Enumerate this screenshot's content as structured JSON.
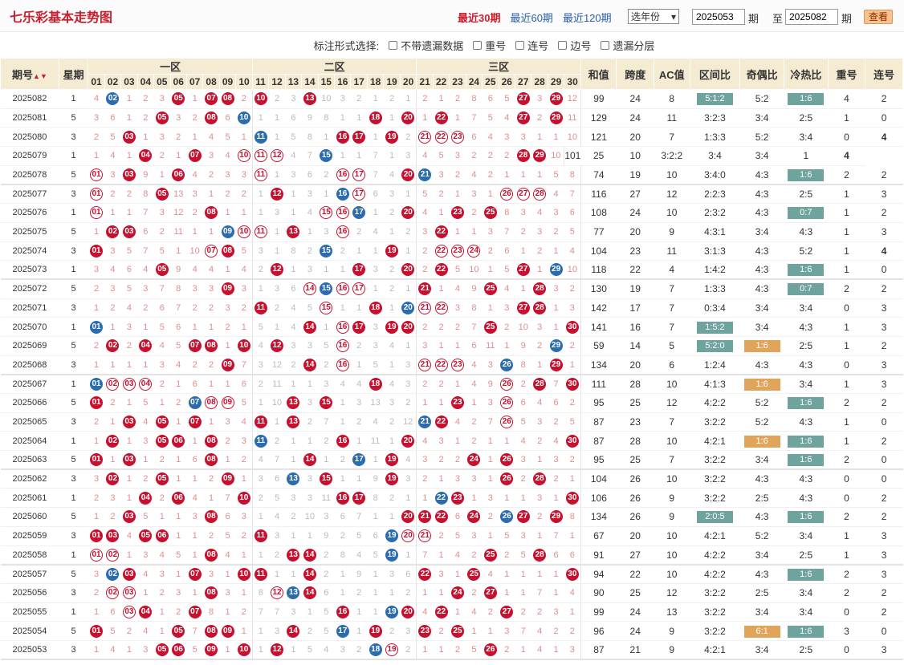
{
  "title": "七乐彩基本走势图",
  "periods": [
    {
      "label": "最近30期",
      "active": true
    },
    {
      "label": "最近60期",
      "active": false
    },
    {
      "label": "最近120期",
      "active": false
    }
  ],
  "year_select": "选年份",
  "range": {
    "from": "2025053",
    "to": "2025082",
    "qi": "期",
    "zhi": "至",
    "btn": "查看"
  },
  "opts": {
    "label": "标注形式选择:",
    "items": [
      "不带遗漏数据",
      "重号",
      "连号",
      "边号",
      "遗漏分层"
    ]
  },
  "headers": {
    "pid": "期号",
    "week": "星期",
    "z1": "一区",
    "z2": "二区",
    "z3": "三区",
    "sum": "和值",
    "span": "跨度",
    "ac": "AC值",
    "qjb": "区间比",
    "job": "奇偶比",
    "lrb": "冷热比",
    "chong": "重号",
    "lian": "连号"
  },
  "nums": [
    "01",
    "02",
    "03",
    "04",
    "05",
    "06",
    "07",
    "08",
    "09",
    "10",
    "11",
    "12",
    "13",
    "14",
    "15",
    "16",
    "17",
    "18",
    "19",
    "20",
    "21",
    "22",
    "23",
    "24",
    "25",
    "26",
    "27",
    "28",
    "29",
    "30"
  ],
  "rows": [
    {
      "id": "2025082",
      "w": "1",
      "c": "4 B02 1 2 3 R05 1 R07 R08 2 R10 2 3 R13 10 3 2 1 2 1 2 1 2 8 6 5 R27 3 R29 12",
      "s": [
        "99",
        "24",
        "8",
        "5:1:2",
        "5:2",
        "1:6",
        "4",
        "2"
      ],
      "t": [
        1,
        0,
        1
      ]
    },
    {
      "id": "2025081",
      "w": "5",
      "c": "3 6 1 2 R05 3 2 R08 6 B10 1 1 6 9 8 1 1 R18 1 R20 1 R22 1 7 5 4 R27 2 R29 11",
      "s": [
        "129",
        "24",
        "11",
        "3:2:3",
        "3:4",
        "2:5",
        "1",
        "0"
      ],
      "t": [
        0,
        0,
        0
      ]
    },
    {
      "id": "2025080",
      "w": "3",
      "c": "2 5 R03 1 3 2 1 4 5 1 B11 1 5 8 1 R16 R17 1 R19 2 O21 O22 O23 6 4 3 3 1 1 10",
      "s": [
        "121",
        "20",
        "7",
        "1:3:3",
        "5:2",
        "3:4",
        "0",
        "4"
      ],
      "t": [
        0,
        0,
        0
      ]
    },
    {
      "id": "2025079",
      "w": "1",
      "c": "1 4 1 R04 2 1 R07 3 4 O10 O11 O12 4 7 B15 1 1 7 1 3 4 5 3 2 2 2 R28 R29 10",
      "s": [
        "101",
        "25",
        "10",
        "3:2:2",
        "3:4",
        "3:4",
        "1",
        "4"
      ],
      "t": [
        0,
        0,
        0
      ]
    },
    {
      "id": "2025078",
      "w": "5",
      "c": "O01 3 R03 9 1 R06 4 2 3 3 O11 1 3 6 2 O16 O17 7 4 R20 B21 3 2 4 2 1 1 1 5 8",
      "s": [
        "74",
        "19",
        "10",
        "3:4:0",
        "4:3",
        "1:6",
        "2",
        "2"
      ],
      "t": [
        0,
        0,
        1
      ],
      "end": true
    },
    {
      "id": "2025077",
      "w": "3",
      "c": "O01 2 2 8 R05 13 3 1 2 2 1 R12 1 3 1 B16 O17 6 3 1 5 2 1 3 1 O26 O27 O28 4 7",
      "s": [
        "116",
        "27",
        "12",
        "2:2:3",
        "4:3",
        "2:5",
        "1",
        "3"
      ],
      "t": [
        0,
        0,
        0
      ]
    },
    {
      "id": "2025076",
      "w": "1",
      "c": "O01 1 1 7 3 12 2 R08 1 1 1 3 1 4 O15 O16 B17 1 2 R20 4 1 R23 2 R25 8 3 4 3 6",
      "s": [
        "108",
        "24",
        "10",
        "2:3:2",
        "4:3",
        "0:7",
        "1",
        "2"
      ],
      "t": [
        0,
        0,
        1
      ]
    },
    {
      "id": "2025075",
      "w": "5",
      "c": "1 R02 R03 6 2 11 1 1 B09 O10 O11 1 R13 1 3 O16 2 4 1 2 3 R22 1 1 3 7 2 3 2 5",
      "s": [
        "77",
        "20",
        "9",
        "4:3:1",
        "3:4",
        "4:3",
        "1",
        "3"
      ],
      "t": [
        0,
        0,
        0
      ]
    },
    {
      "id": "2025074",
      "w": "3",
      "c": "R01 3 5 7 5 1 10 O07 R08 5 3 1 8 2 B15 2 1 1 R19 1 2 O22 O23 O24 2 6 1 2 1 4",
      "s": [
        "104",
        "23",
        "11",
        "3:1:3",
        "4:3",
        "5:2",
        "1",
        "4"
      ],
      "t": [
        0,
        0,
        0
      ]
    },
    {
      "id": "2025073",
      "w": "1",
      "c": "3 4 6 4 R05 9 4 4 1 4 2 R12 1 3 1 1 R17 3 2 R20 2 R22 5 10 1 5 R27 1 B29 10",
      "s": [
        "118",
        "22",
        "4",
        "1:4:2",
        "4:3",
        "1:6",
        "1",
        "0"
      ],
      "t": [
        0,
        0,
        1
      ],
      "end": true
    },
    {
      "id": "2025072",
      "w": "5",
      "c": "2 3 5 3 7 8 3 3 R09 3 1 3 6 O14 B15 O16 O17 1 2 1 R21 1 4 9 R25 4 1 R28 3 2",
      "s": [
        "130",
        "19",
        "7",
        "1:3:3",
        "4:3",
        "0:7",
        "2",
        "2"
      ],
      "t": [
        0,
        0,
        1
      ]
    },
    {
      "id": "2025071",
      "w": "3",
      "c": "1 2 4 2 6 7 2 2 3 2 R11 2 4 5 O15 1 1 R18 1 B20 O21 O22 3 8 1 3 R27 R28 1 3",
      "s": [
        "142",
        "17",
        "7",
        "0:3:4",
        "3:4",
        "3:4",
        "0",
        "3"
      ],
      "t": [
        0,
        0,
        0
      ]
    },
    {
      "id": "2025070",
      "w": "1",
      "c": "B01 1 3 1 5 6 1 1 2 1 5 1 4 R14 1 O16 R17 3 R19 R20 2 2 2 7 R25 2 10 3 1 R30",
      "s": [
        "141",
        "16",
        "7",
        "1:5:2",
        "3:4",
        "4:3",
        "1",
        "3"
      ],
      "t": [
        1,
        0,
        0
      ]
    },
    {
      "id": "2025069",
      "w": "5",
      "c": "2 R02 2 R04 4 5 R07 R08 1 R10 4 R12 3 3 5 O16 2 3 4 1 3 1 1 6 11 1 9 2 B29 2",
      "s": [
        "59",
        "14",
        "5",
        "5:2:0",
        "1:6",
        "2:5",
        "1",
        "2"
      ],
      "t": [
        1,
        1,
        0
      ]
    },
    {
      "id": "2025068",
      "w": "3",
      "c": "1 1 1 1 3 4 2 2 R09 7 3 12 2 R14 2 O16 1 5 1 3 O21 O22 O23 4 3 B26 8 1 R29 1",
      "s": [
        "134",
        "20",
        "6",
        "1:2:4",
        "4:3",
        "4:3",
        "0",
        "3"
      ],
      "t": [
        0,
        0,
        0
      ],
      "end": true
    },
    {
      "id": "2025067",
      "w": "1",
      "c": "B01 O02 O03 O04 2 1 6 1 1 6 2 11 1 1 3 4 4 R18 4 3 2 2 1 4 9 O26 2 R28 7 R30",
      "s": [
        "111",
        "28",
        "10",
        "4:1:3",
        "1:6",
        "3:4",
        "1",
        "3"
      ],
      "t": [
        0,
        1,
        0
      ]
    },
    {
      "id": "2025066",
      "w": "5",
      "c": "R01 2 1 5 1 2 B07 O08 O09 5 1 10 R13 3 R15 1 3 13 3 2 1 1 R23 1 3 O26 6 4 6 2",
      "s": [
        "95",
        "25",
        "12",
        "4:2:2",
        "5:2",
        "1:6",
        "2",
        "2"
      ],
      "t": [
        0,
        0,
        1
      ]
    },
    {
      "id": "2025065",
      "w": "3",
      "c": "2 1 R03 4 R05 1 R07 1 3 4 R11 1 R13 2 7 1 2 4 2 12 B21 R22 4 2 7 O26 5 3 2 5",
      "s": [
        "87",
        "23",
        "7",
        "3:2:2",
        "5:2",
        "4:3",
        "1",
        "0"
      ],
      "t": [
        0,
        0,
        0
      ]
    },
    {
      "id": "2025064",
      "w": "1",
      "c": "1 R02 1 3 R05 R06 1 R08 2 3 B11 2 1 1 2 R16 1 11 1 R20 4 3 1 2 1 1 4 2 4 R30",
      "s": [
        "87",
        "28",
        "10",
        "4:2:1",
        "1:6",
        "1:6",
        "1",
        "2"
      ],
      "t": [
        0,
        1,
        1
      ]
    },
    {
      "id": "2025063",
      "w": "5",
      "c": "R01 1 R03 1 2 1 6 R08 1 2 4 7 1 R14 1 2 B17 1 R19 4 3 2 2 R24 1 R26 3 1 3 2",
      "s": [
        "95",
        "25",
        "7",
        "3:2:2",
        "3:4",
        "1:6",
        "2",
        "0"
      ],
      "t": [
        0,
        0,
        1
      ],
      "end": true
    },
    {
      "id": "2025062",
      "w": "3",
      "c": "3 R02 1 2 R05 1 1 2 R09 1 3 6 B13 3 R15 1 1 9 R19 3 2 1 3 3 1 R26 2 R28 2 1",
      "s": [
        "104",
        "26",
        "10",
        "3:2:2",
        "4:3",
        "4:3",
        "0",
        "0"
      ],
      "t": [
        0,
        0,
        0
      ]
    },
    {
      "id": "2025061",
      "w": "1",
      "c": "2 3 1 R04 2 R06 4 1 7 R10 2 5 3 3 11 R16 R17 8 2 1 1 B22 R23 1 3 1 1 3 1 R30",
      "s": [
        "106",
        "26",
        "9",
        "3:2:2",
        "2:5",
        "4:3",
        "0",
        "2"
      ],
      "t": [
        0,
        0,
        0
      ]
    },
    {
      "id": "2025060",
      "w": "5",
      "c": "1 2 R03 5 1 1 3 R08 6 3 1 4 2 10 3 6 7 1 1 R20 R21 R22 6 R24 2 B26 R27 2 R29 8",
      "s": [
        "134",
        "26",
        "9",
        "2:0:5",
        "4:3",
        "1:6",
        "2",
        "2"
      ],
      "t": [
        1,
        0,
        1
      ]
    },
    {
      "id": "2025059",
      "w": "3",
      "c": "R01 R03 4 R05 R06 1 1 2 5 2 R11 3 1 1 9 2 5 6 B19 O20 O21 2 5 3 1 5 3 1 7 1",
      "s": [
        "67",
        "20",
        "10",
        "4:2:1",
        "5:2",
        "3:4",
        "1",
        "3"
      ],
      "t": [
        0,
        0,
        0
      ]
    },
    {
      "id": "2025058",
      "w": "1",
      "c": "O01 O02 1 3 4 5 1 R08 4 1 1 2 R13 R14 2 8 4 5 B19 1 7 1 4 2 R25 2 5 R28 6 6",
      "s": [
        "91",
        "27",
        "10",
        "4:2:2",
        "3:4",
        "2:5",
        "1",
        "3"
      ],
      "t": [
        0,
        0,
        0
      ],
      "end": true
    },
    {
      "id": "2025057",
      "w": "5",
      "c": "3 B02 R03 4 3 1 R07 3 1 R10 R11 1 1 R14 2 1 9 1 3 6 R22 3 1 R25 4 1 1 1 1 R30",
      "s": [
        "94",
        "22",
        "10",
        "4:2:2",
        "4:3",
        "1:6",
        "2",
        "3"
      ],
      "t": [
        0,
        0,
        1
      ]
    },
    {
      "id": "2025056",
      "w": "3",
      "c": "2 O02 O03 1 2 3 1 R08 3 1 8 O12 B13 R14 6 1 2 1 1 2 1 1 R24 2 R27 1 1 7 1 4",
      "s": [
        "90",
        "25",
        "12",
        "3:2:2",
        "2:5",
        "3:4",
        "2",
        "2"
      ],
      "t": [
        0,
        0,
        0
      ]
    },
    {
      "id": "2025055",
      "w": "1",
      "c": "1 6 O03 R04 1 2 R07 8 1 2 7 7 3 1 5 R16 1 1 B19 R20 4 R22 1 4 2 R27 2 2 3 1",
      "s": [
        "99",
        "24",
        "13",
        "3:2:2",
        "3:4",
        "3:4",
        "0",
        "2"
      ],
      "t": [
        0,
        0,
        0
      ]
    },
    {
      "id": "2025054",
      "w": "5",
      "c": "R01 5 2 4 1 R05 7 R08 R09 1 1 3 R14 2 5 B17 1 R19 2 3 R23 2 R25 1 1 3 7 4 2 2",
      "s": [
        "96",
        "24",
        "9",
        "3:2:2",
        "6:1",
        "1:6",
        "3",
        "0"
      ],
      "t": [
        0,
        1,
        1
      ]
    },
    {
      "id": "2025053",
      "w": "3",
      "c": "1 4 1 3 R05 R06 5 R09 1 R10 1 R12 1 5 4 3 2 B18 O19 2 1 1 2 5 R26 2 1 4 1 3",
      "s": [
        "87",
        "21",
        "9",
        "4:2:1",
        "3:4",
        "2:5",
        "0",
        "3"
      ],
      "t": [
        0,
        0,
        0
      ],
      "end": true
    }
  ]
}
